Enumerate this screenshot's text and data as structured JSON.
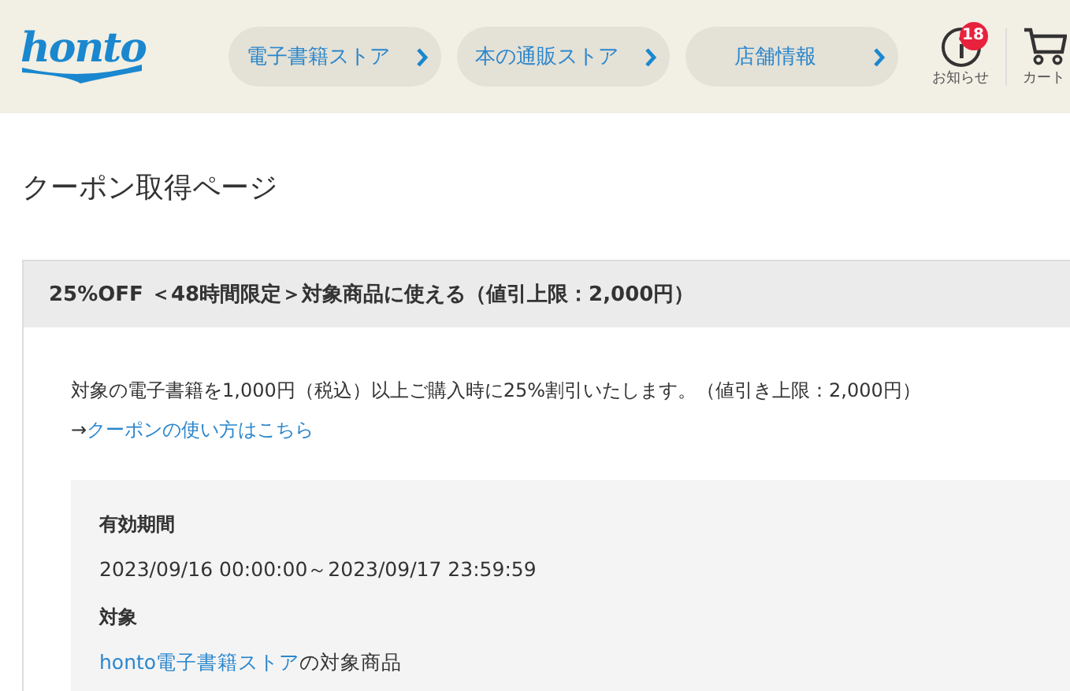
{
  "header": {
    "logo": "honto",
    "nav": [
      {
        "label": "電子書籍ストア"
      },
      {
        "label": "本の通販ストア"
      },
      {
        "label": "店舗情報"
      }
    ],
    "notice": {
      "label": "お知らせ",
      "badge": "18"
    },
    "cart": {
      "label": "カート"
    }
  },
  "page_title": "クーポン取得ページ",
  "coupon": {
    "title": "25%OFF ＜48時間限定＞対象商品に使える（値引上限：2,000円）",
    "description": "対象の電子書籍を1,000円（税込）以上ご購入時に25%割引いたします。（値引き上限：2,000円）",
    "howto_arrow": "→",
    "howto_link": "クーポンの使い方はこちら",
    "details": [
      {
        "label": "有効期間",
        "value": "2023/09/16 00:00:00～2023/09/17 23:59:59"
      },
      {
        "label": "対象",
        "link": "honto電子書籍ストア",
        "value": "の対象商品"
      }
    ]
  }
}
